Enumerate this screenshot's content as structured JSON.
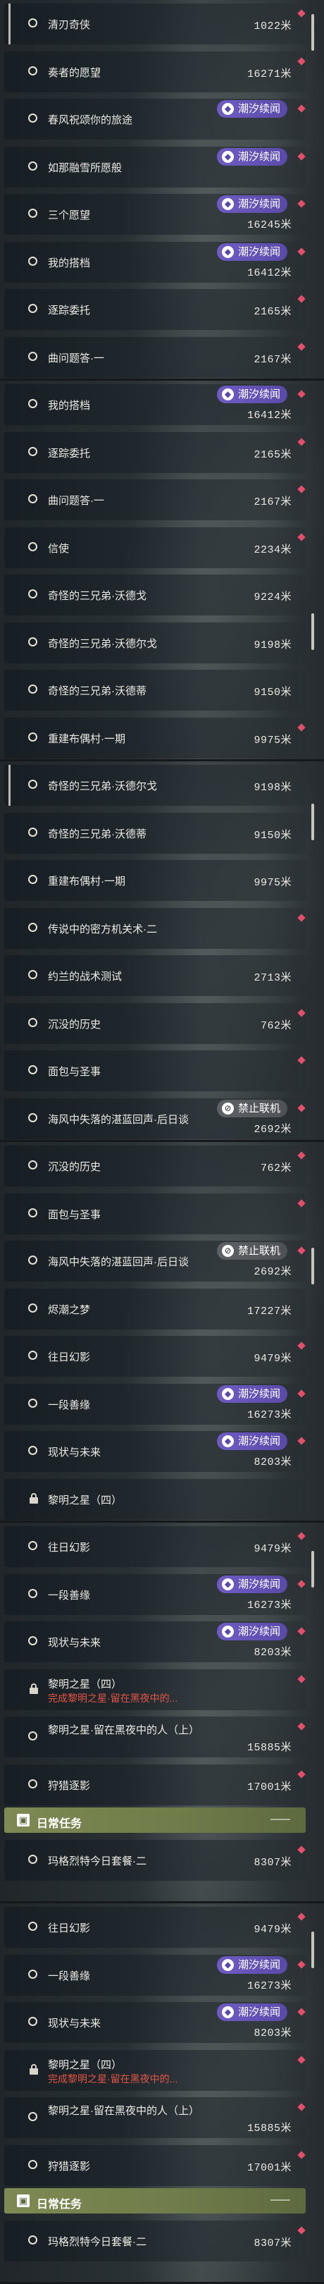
{
  "panels": [
    {
      "rows": [
        {
          "name": "清刃奇侠",
          "distance": "1022米",
          "mark": true,
          "highlight": true
        },
        {
          "name": "奏者的愿望",
          "distance": "16271米",
          "mark": true
        },
        {
          "name": "春风祝颂你的旅途",
          "badge": "潮汐续闻",
          "mark": true
        },
        {
          "name": "如那融雪所愿般",
          "badge": "潮汐续闻",
          "mark": true
        },
        {
          "name": "三个愿望",
          "distance": "16245米",
          "badge": "潮汐续闻",
          "mark": true
        },
        {
          "name": "我的搭档",
          "distance": "16412米",
          "badge": "潮汐续闻",
          "mark": true
        },
        {
          "name": "逐踪委托",
          "distance": "2165米",
          "mark": true
        },
        {
          "name": "曲问题答·一",
          "distance": "2167米",
          "mark": true
        }
      ]
    },
    {
      "rows": [
        {
          "name": "我的搭档",
          "distance": "16412米",
          "badge": "潮汐续闻",
          "mark": true
        },
        {
          "name": "逐踪委托",
          "distance": "2165米",
          "mark": true
        },
        {
          "name": "曲问题答·一",
          "distance": "2167米",
          "mark": true
        },
        {
          "name": "信使",
          "distance": "2234米",
          "mark": true
        },
        {
          "name": "奇怪的三兄弟·沃德戈",
          "distance": "9224米"
        },
        {
          "name": "奇怪的三兄弟·沃德尔戈",
          "distance": "9198米"
        },
        {
          "name": "奇怪的三兄弟·沃德蒂",
          "distance": "9150米"
        },
        {
          "name": "重建布偶村·一期",
          "distance": "9975米",
          "mark": true
        }
      ]
    },
    {
      "rows": [
        {
          "name": "奇怪的三兄弟·沃德尔戈",
          "distance": "9198米",
          "highlight": true
        },
        {
          "name": "奇怪的三兄弟·沃德蒂",
          "distance": "9150米"
        },
        {
          "name": "重建布偶村·一期",
          "distance": "9975米"
        },
        {
          "name": "传说中的密方机关术·二",
          "mark": true
        },
        {
          "name": "约兰的战术测试",
          "distance": "2713米"
        },
        {
          "name": "沉没的历史",
          "distance": "762米",
          "mark": true
        },
        {
          "name": "面包与圣事",
          "mark": true
        },
        {
          "name": "海风中失落的湛蓝回声·后日谈",
          "distance": "2692米",
          "badge": "禁止联机",
          "badge_type": "grey",
          "mark": true
        }
      ]
    },
    {
      "rows": [
        {
          "name": "沉没的历史",
          "distance": "762米",
          "mark": true
        },
        {
          "name": "面包与圣事",
          "mark": true
        },
        {
          "name": "海风中失落的湛蓝回声·后日谈",
          "distance": "2692米",
          "badge": "禁止联机",
          "badge_type": "grey",
          "mark": true
        },
        {
          "name": "烬潮之梦",
          "distance": "17227米"
        },
        {
          "name": "往日幻影",
          "distance": "9479米",
          "mark": true
        },
        {
          "name": "一段善缘",
          "distance": "16273米",
          "badge": "潮汐续闻",
          "mark": true
        },
        {
          "name": "现状与未来",
          "distance": "8203米",
          "badge": "潮汐续闻",
          "mark": true
        },
        {
          "name": "黎明之星（四）",
          "locked": true
        }
      ]
    },
    {
      "rows": [
        {
          "name": "往日幻影",
          "distance": "9479米",
          "mark": true
        },
        {
          "name": "一段善缘",
          "distance": "16273米",
          "badge": "潮汐续闻",
          "mark": true
        },
        {
          "name": "现状与未来",
          "distance": "8203米",
          "badge": "潮汐续闻",
          "mark": true
        },
        {
          "name": "黎明之星（四）",
          "locked": true,
          "sub": "完成黎明之星·留在黑夜中的...",
          "mark": true
        },
        {
          "name": "黎明之星·留在黑夜中的人（上）",
          "distance": "15885米",
          "two_line": true,
          "mark": true
        },
        {
          "name": "狩猎逐影",
          "distance": "17001米",
          "mark": true
        }
      ],
      "header": "日常任务",
      "daily": {
        "name": "玛格烈特今日套餐·二",
        "distance": "8307米",
        "mark": true
      }
    },
    {
      "rows": [
        {
          "name": "往日幻影",
          "distance": "9479米",
          "mark": true
        },
        {
          "name": "一段善缘",
          "distance": "16273米",
          "badge": "潮汐续闻",
          "mark": true
        },
        {
          "name": "现状与未来",
          "distance": "8203米",
          "badge": "潮汐续闻",
          "mark": true
        },
        {
          "name": "黎明之星（四）",
          "locked": true,
          "sub": "完成黎明之星·留在黑夜中的...",
          "mark": true
        },
        {
          "name": "黎明之星·留在黑夜中的人（上）",
          "distance": "15885米",
          "two_line": true,
          "mark": true
        },
        {
          "name": "狩猎逐影",
          "distance": "17001米",
          "mark": true
        }
      ],
      "header": "日常任务",
      "daily": {
        "name": "玛格烈特今日套餐·二",
        "distance": "8307米",
        "mark": true
      }
    }
  ]
}
